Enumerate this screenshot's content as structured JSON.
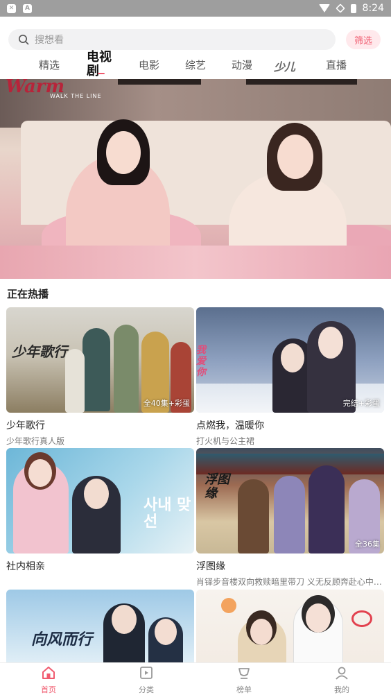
{
  "status_bar": {
    "time": "8:24",
    "left_icons": [
      "shield-x-icon",
      "a-icon"
    ],
    "right_icons": [
      "wifi-icon",
      "no-signal-icon",
      "battery-icon"
    ]
  },
  "search": {
    "placeholder": "搜想看"
  },
  "filter_button": {
    "label": "筛选"
  },
  "tabs": [
    {
      "label": "精选",
      "active": false
    },
    {
      "label": "电视剧",
      "active": true
    },
    {
      "label": "电影",
      "active": false
    },
    {
      "label": "综艺",
      "active": false
    },
    {
      "label": "动漫",
      "active": false
    },
    {
      "label": "少儿",
      "active": false
    },
    {
      "label": "直播",
      "active": false
    }
  ],
  "hero": {
    "title": "Warm",
    "subtitle": "WALK THE LINE"
  },
  "section": {
    "title": "正在热播"
  },
  "cards": [
    {
      "name": "少年歌行",
      "desc": "少年歌行真人版",
      "badge": "全40集+彩蛋",
      "poster_text": "少年歌行"
    },
    {
      "name": "点燃我，温暖你",
      "desc": "打火机与公主裙",
      "badge": "完结+彩蛋",
      "poster_text": "我爱你"
    },
    {
      "name": "社内相亲",
      "desc": "",
      "badge": "",
      "poster_text": "사내 맞선"
    },
    {
      "name": "浮图缘",
      "desc": "肖铎步音楼双向救赎暗里带刀 义无反顾奔赴心中所...",
      "badge": "全36集",
      "poster_text": "浮图缘"
    },
    {
      "name": "",
      "desc": "",
      "badge": "",
      "poster_text": "向风而行"
    },
    {
      "name": "",
      "desc": "",
      "badge": "",
      "poster_text": ""
    }
  ],
  "bottom_nav": [
    {
      "label": "首页",
      "icon": "home-icon",
      "active": true
    },
    {
      "label": "分类",
      "icon": "category-icon",
      "active": false
    },
    {
      "label": "榜单",
      "icon": "ranking-icon",
      "active": false
    },
    {
      "label": "我的",
      "icon": "profile-icon",
      "active": false
    }
  ],
  "colors": {
    "accent": "#f05a6e",
    "status_bar": "#9e9e9e"
  }
}
